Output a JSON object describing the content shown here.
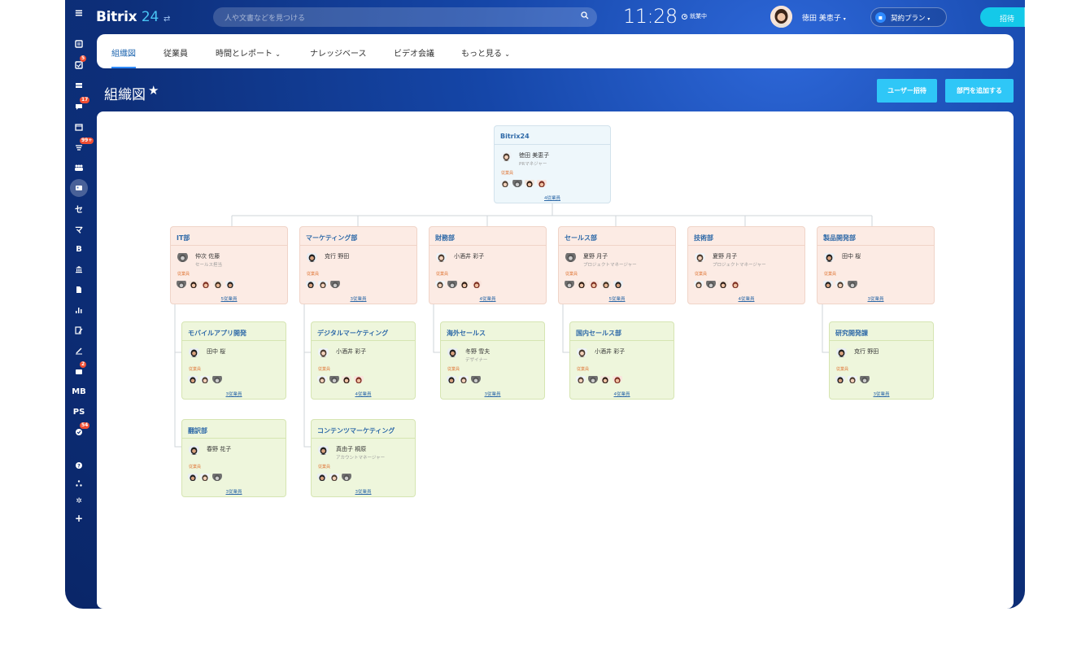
{
  "app": {
    "logo_main": "Bitrix",
    "logo_num": "24",
    "logo_switch": "⇄"
  },
  "search": {
    "placeholder": "人や文書などを見つける"
  },
  "clock": "11:28",
  "status": "就業中",
  "user": {
    "name": "徳田 美恵子"
  },
  "plan": {
    "label": "契約プラン"
  },
  "invite": {
    "label": "招待"
  },
  "sidebar": {
    "badges": {
      "tasks": "5",
      "chat": "17",
      "stream": "99+",
      "crm": "2",
      "check": "54"
    },
    "labels": {
      "t": "セ",
      "m": "マ",
      "b": "B",
      "mb": "MB",
      "ps": "PS"
    }
  },
  "tabs": [
    "組織図",
    "従業員",
    "時間とレポート",
    "ナレッジベース",
    "ビデオ会議",
    "もっと見る"
  ],
  "page": {
    "title": "組織図",
    "btn_invite": "ユーザー招待",
    "btn_add_dept": "部門を追加する"
  },
  "org": {
    "emp_label": "従業員",
    "root": {
      "title": "Bitrix24",
      "head": "徳田 美恵子",
      "position": "PRマネジャー",
      "count": "4従業員"
    },
    "depts": [
      {
        "title": "IT部",
        "head": "仲次 佐藤",
        "position": "セールス担当",
        "count": "5従業員"
      },
      {
        "title": "マーケティング部",
        "head": "克行 野田",
        "position": "",
        "count": "3従業員"
      },
      {
        "title": "財務部",
        "head": "小酒井 彩子",
        "position": "",
        "count": "4従業員"
      },
      {
        "title": "セールス部",
        "head": "夏野 月子",
        "position": "プロジェクトマネージャー",
        "count": "5従業員"
      },
      {
        "title": "技術部",
        "head": "夏野 月子",
        "position": "プロジェクトマネージャー",
        "count": "4従業員"
      },
      {
        "title": "製品開発部",
        "head": "田中 桜",
        "position": "",
        "count": "3従業員"
      }
    ],
    "subs": [
      {
        "title": "モバイルアプリ開発",
        "head": "田中 桜",
        "position": "",
        "count": "3従業員"
      },
      {
        "title": "翻訳部",
        "head": "春野 花子",
        "position": "",
        "count": "3従業員"
      },
      {
        "title": "デジタルマーケティング",
        "head": "小酒井 彩子",
        "position": "",
        "count": "4従業員"
      },
      {
        "title": "コンテンツマーケティング",
        "head": "真由子 桐原",
        "position": "アカウントマネージャー",
        "count": "3従業員"
      },
      {
        "title": "海外セールス",
        "head": "冬野 雪夫",
        "position": "デザイナー",
        "count": "3従業員"
      },
      {
        "title": "国内セールス部",
        "head": "小酒井 彩子",
        "position": "",
        "count": "4従業員"
      },
      {
        "title": "研究開発課",
        "head": "克行 野田",
        "position": "",
        "count": "3従業員"
      }
    ]
  }
}
